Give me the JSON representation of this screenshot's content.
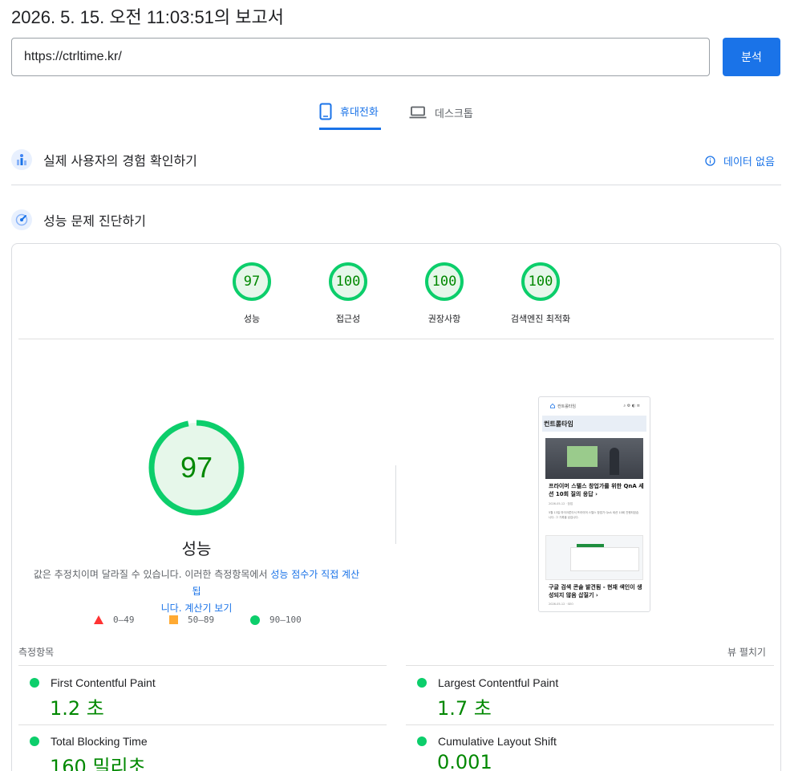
{
  "report": {
    "title": "2026. 5. 15. 오전 11:03:51의 보고서"
  },
  "url_bar": {
    "value": "https://ctrltime.kr/",
    "button_label": "분석"
  },
  "tabs": [
    {
      "label": "휴대전화",
      "icon": "smartphone-icon",
      "active": true
    },
    {
      "label": "데스크톱",
      "icon": "laptop-icon",
      "active": false
    }
  ],
  "crux": {
    "title": "실제 사용자의 경험 확인하기",
    "status": "데이터 없음",
    "icon": "info-icon"
  },
  "diagnose": {
    "title": "성능 문제 진단하기"
  },
  "categories": [
    {
      "score": "97",
      "label": "성능"
    },
    {
      "score": "100",
      "label": "접근성"
    },
    {
      "score": "100",
      "label": "권장사항"
    },
    {
      "score": "100",
      "label": "검색엔진 최적화"
    }
  ],
  "performance": {
    "score": "97",
    "score_fraction": 0.97,
    "title": "성능",
    "desc_prefix": "값은 추정치이며 달라질 수 있습니다. 이러한 측정항목에서 ",
    "desc_link1": "성능 점수가 직접 계산됩",
    "desc_link1b": "니다.",
    "desc_link2": "계산기 보기",
    "legend": {
      "fail": "0–49",
      "average": "50–89",
      "pass": "90–100"
    },
    "colors": {
      "pass": "#0cce6b",
      "average": "#ffaa33",
      "fail": "#ff3333",
      "accent": "#1a73e8"
    }
  },
  "screenshot": {
    "brand": "컨트롤타임",
    "heading": "컨트롤타임",
    "post1_title": "프라이머 스텔스 창업가를 위한 QnA 세션 10회 질의 응답 ›",
    "post1_meta": "2026-05-12 · 창업",
    "post1_excerpt": "5월 13일 마이크론이서 프라이머 스텔스 창업가 QnA 세션 10회 진행되었습니다. 그 기록을 남깁니다.",
    "post2_title": "구글 검색 콘솔 발견됨 - 현재 색인이 생성되지 않음 삽질기 ›",
    "post2_meta": "2026-05-12 · SEO"
  },
  "metrics": {
    "section_label": "측정항목",
    "expand_label": "뷰 펼치기",
    "items": [
      {
        "name": "First Contentful Paint",
        "value": "1.2 초"
      },
      {
        "name": "Largest Contentful Paint",
        "value": "1.7 초"
      },
      {
        "name": "Total Blocking Time",
        "value": "160 밀리초"
      },
      {
        "name": "Cumulative Layout Shift",
        "value": "0.001"
      }
    ]
  }
}
